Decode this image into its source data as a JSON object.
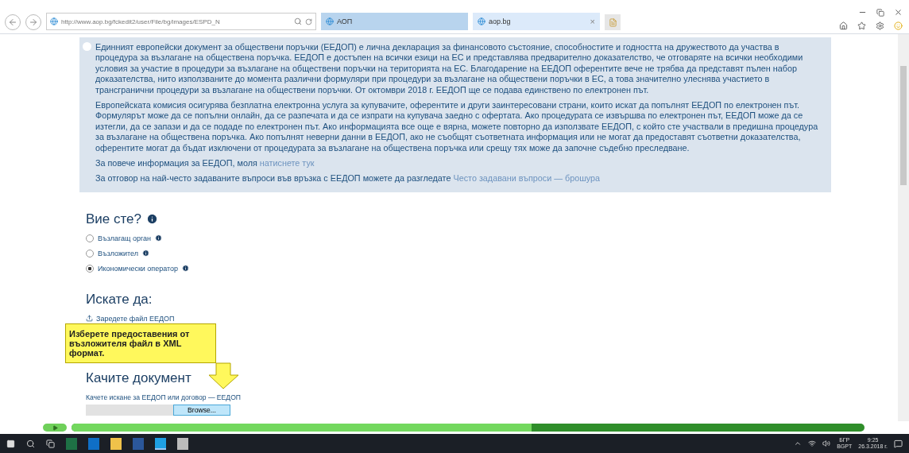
{
  "browser": {
    "address": "http://www.aop.bg/fckedit2/user/File/bg/images/ESPD_N",
    "tabs": [
      {
        "label": "АОП",
        "selected": true
      },
      {
        "label": "aop.bg",
        "selected": false,
        "close": "×"
      }
    ]
  },
  "info": {
    "paragraphs": [
      {
        "text": "Единният европейски документ за обществени поръчки (ЕЕДОП) е лична декларация за финансовото състояние, способностите и годността на дружеството да участва в процедура за възлагане на обществена поръчка. ЕЕДОП е достъпен на всички езици на ЕС и представлява предварително доказателство, че отговаряте на всички необходими условия за участие в процедури за възлагане на обществени поръчки на територията на ЕС. Благодарение на ЕЕДОП оферентите вече не трябва да представят пълен набор доказателства, нито използваните до момента различни формуляри при процедури за възлагане на обществени поръчки в ЕС, а това значително улеснява участието в трансгранични процедури за възлагане на обществени поръчки. От октомври 2018 г. ЕЕДОП ще се подава единствено по електронен път."
      },
      {
        "text": "Европейската комисия осигурява безплатна електронна услуга за купувачите, оферентите и други заинтересовани страни, които искат да попълнят ЕЕДОП по електронен път. Формулярът може да се попълни онлайн, да се разпечата и да се изпрати на купувача заедно с офертата. Ако процедурата се извършва по електронен път, ЕЕДОП може да се изтегли, да се запази и да се подаде по електронен път. Ако информацията все още е вярна, можете повторно да използвате ЕЕДОП, с който сте участвали в предишна процедура за възлагане на обществена поръчка. Ако попълнят неверни данни в ЕЕДОП, ако не съобщят съответната информация или не могат да предоставят съответни доказателства, оферентите могат да бъдат изключени от процедурата за възлагане на обществена поръчка или срещу тях може да започне съдебно преследване."
      },
      {
        "text": "За повече информация за ЕЕДОП, моля",
        "link": "натиснете тук"
      },
      {
        "text": "За отговор на най-често задаваните въпроси във връзка с ЕЕДОП можете да разгледате",
        "link": "Често задавани въпроси — брошура"
      }
    ]
  },
  "who": {
    "heading": "Вие сте?",
    "options": [
      {
        "label": "Възлагащ орган",
        "selected": false
      },
      {
        "label": "Възложител",
        "selected": false
      },
      {
        "label": "Икономически оператор",
        "selected": true
      }
    ]
  },
  "want": {
    "heading": "Искате да:",
    "action": "Заредете файл ЕЕДОП"
  },
  "upload": {
    "heading": "Качите документ",
    "hint": "Качете искане за ЕЕДОП или договор — ЕЕДОП",
    "browse": "Browse..."
  },
  "callout": {
    "text": "Изберете предоставения от възложителя файл в XML формат."
  },
  "player": {
    "level": 0.58
  },
  "taskbar": {
    "apps": [
      {
        "kind": "excel",
        "active": false
      },
      {
        "kind": "outlook",
        "active": false
      },
      {
        "kind": "explorer",
        "active": false
      },
      {
        "kind": "word",
        "active": false
      },
      {
        "kind": "ie",
        "active": true
      },
      {
        "kind": "calculator",
        "active": false
      }
    ],
    "language": "БГР",
    "layout": "BGPT",
    "time": "9:25",
    "date": "26.3.2018 г."
  }
}
